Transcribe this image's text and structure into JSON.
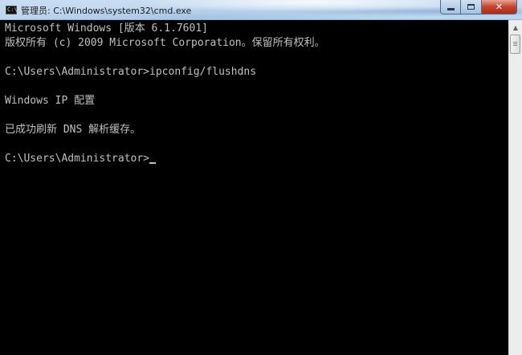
{
  "window": {
    "title": "管理员: C:\\Windows\\system32\\cmd.exe",
    "icon": "cmd-icon",
    "icon_glyph": "C:\\",
    "buttons": {
      "minimize": "minimize-icon",
      "maximize": "maximize-icon",
      "close": "close-icon",
      "close_glyph": "✕"
    }
  },
  "console": {
    "lines": [
      "Microsoft Windows [版本 6.1.7601]",
      "版权所有 (c) 2009 Microsoft Corporation。保留所有权利。",
      "",
      "C:\\Users\\Administrator>ipconfig/flushdns",
      "",
      "Windows IP 配置",
      "",
      "已成功刷新 DNS 解析缓存。",
      "",
      "C:\\Users\\Administrator>"
    ]
  },
  "colors": {
    "console_bg": "#000000",
    "console_text": "#c0c0c0",
    "close_button": "#c4422b"
  }
}
